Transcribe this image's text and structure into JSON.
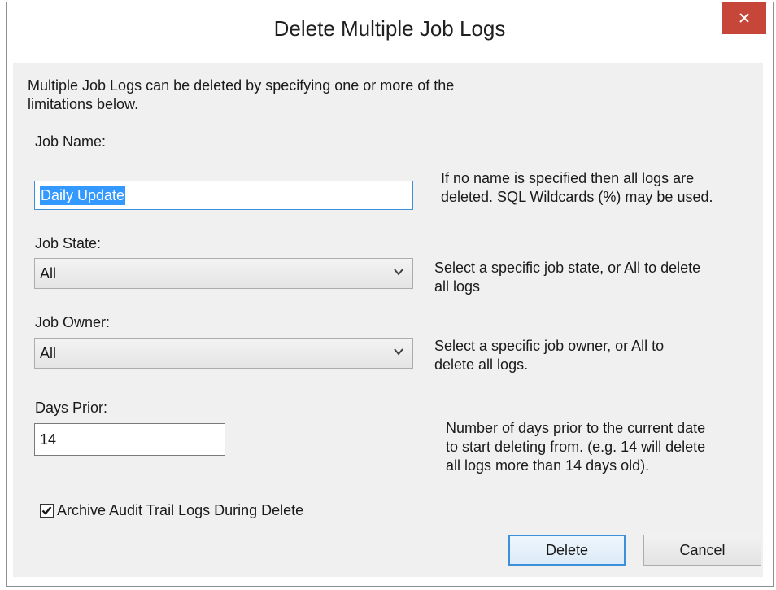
{
  "window": {
    "title": "Delete Multiple Job Logs"
  },
  "intro": "Multiple Job Logs can be deleted by specifying one or more of the\nlimitations below.",
  "job_name": {
    "label": "Job Name:",
    "value": "Daily Update",
    "help": "If no name is specified then all logs are\ndeleted. SQL Wildcards (%) may be used."
  },
  "job_state": {
    "label": "Job State:",
    "selected": "All",
    "help": "Select a specific job state, or All to delete\nall logs"
  },
  "job_owner": {
    "label": "Job Owner:",
    "selected": "All",
    "help": "Select a specific job owner, or All to\ndelete all logs."
  },
  "days_prior": {
    "label": "Days Prior:",
    "value": "14",
    "help": "Number of days prior to the current date\nto start deleting from. (e.g. 14 will delete\nall logs more than 14 days old)."
  },
  "archive": {
    "label": "Archive Audit Trail Logs During Delete",
    "checked": true
  },
  "buttons": {
    "delete": "Delete",
    "cancel": "Cancel"
  },
  "colors": {
    "close_button": "#c7463a",
    "dialog_background": "#f0f0f0",
    "focus_accent": "#3c8fd9",
    "selection": "#3399ff"
  },
  "icons": {
    "close": "close-icon",
    "dropdown": "chevron-down-icon",
    "check": "checkmark-icon"
  }
}
